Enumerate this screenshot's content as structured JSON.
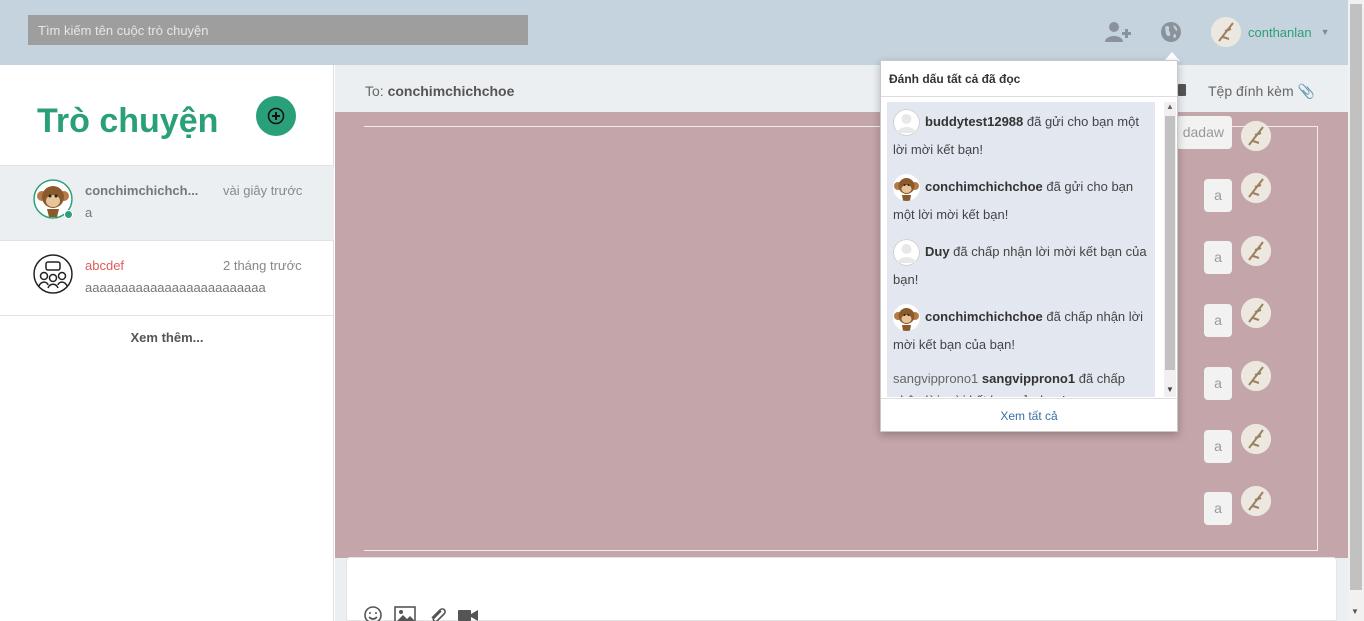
{
  "search": {
    "placeholder": "Tìm kiếm tên cuộc trò chuyện"
  },
  "user": {
    "name": "conthanlan"
  },
  "sidebar": {
    "title": "Trò chuyện",
    "conversations": [
      {
        "name": "conchimchichch...",
        "time": "vài giây trước",
        "last_message": "a"
      },
      {
        "name": "abcdef",
        "time": "2 tháng trước",
        "last_message": "aaaaaaaaaaaaaaaaaaaaaaaaa"
      }
    ],
    "see_more": "Xem thêm..."
  },
  "chat": {
    "to_prefix": "To: ",
    "to_name": "conchimchichchoe",
    "attachments_label": "Tệp đính kèm",
    "messages": [
      "dadaw",
      "a",
      "a",
      "a",
      "a",
      "a",
      "a"
    ]
  },
  "notifications": {
    "header": "Đánh dấu tất cả đã đọc",
    "items": [
      {
        "user": "buddytest12988",
        "text": " đã gửi cho bạn một lời mời kết bạn!"
      },
      {
        "user": "conchimchichchoe",
        "text": " đã gửi cho bạn một lời mời kết bạn!"
      },
      {
        "user": "Duy",
        "text": " đã chấp nhận lời mời kết bạn của bạn!"
      },
      {
        "user": "conchimchichchoe",
        "text": " đã chấp nhận lời mời kết bạn của bạn!"
      },
      {
        "alt": "sangvipprono1",
        "user": "sangvipprono1",
        "text": " đã chấp nhận lời mời kết bạn của bạn!"
      }
    ],
    "footer": "Xem tất cả"
  },
  "colors": {
    "accent": "#2aa07a",
    "topbar": "#c5d3de",
    "chat_background": "#c4a5a9",
    "notification_item": "#e3e8f0",
    "unread_name": "#e05a5a"
  },
  "icons": [
    "add-user-icon",
    "globe-icon",
    "plus-circle-icon",
    "paperclip-icon",
    "smile-icon",
    "image-icon",
    "camera-icon"
  ]
}
